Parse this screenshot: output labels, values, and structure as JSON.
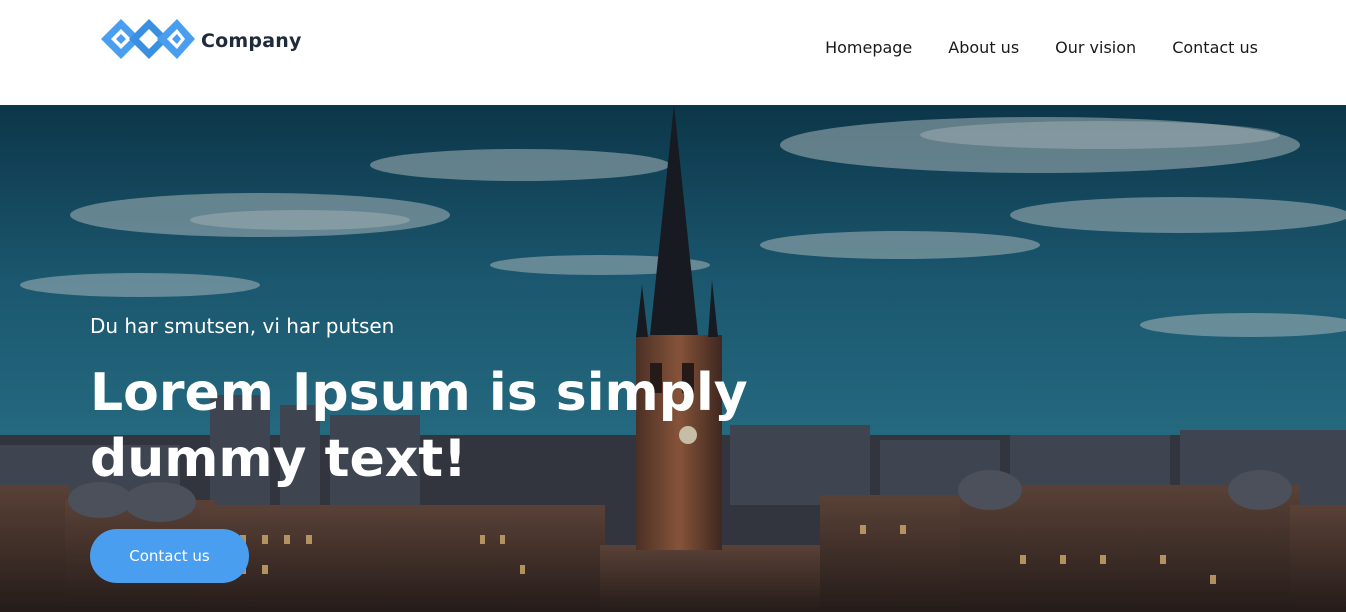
{
  "brand": {
    "name": "Company",
    "logo_icon": "interlocking-squares-logo",
    "logo_color": "#4a9ef0"
  },
  "nav": {
    "items": [
      {
        "label": "Homepage"
      },
      {
        "label": "About us"
      },
      {
        "label": "Our vision"
      },
      {
        "label": "Contact us"
      }
    ]
  },
  "hero": {
    "subtitle": "Du har smutsen, vi har putsen",
    "headline_line1": "Lorem Ipsum is simply",
    "headline_line2": "dummy text!",
    "cta_label": "Contact us",
    "cta_color": "#4a9ef0",
    "background_image": "city-skyline-with-church-spire-at-dusk"
  }
}
